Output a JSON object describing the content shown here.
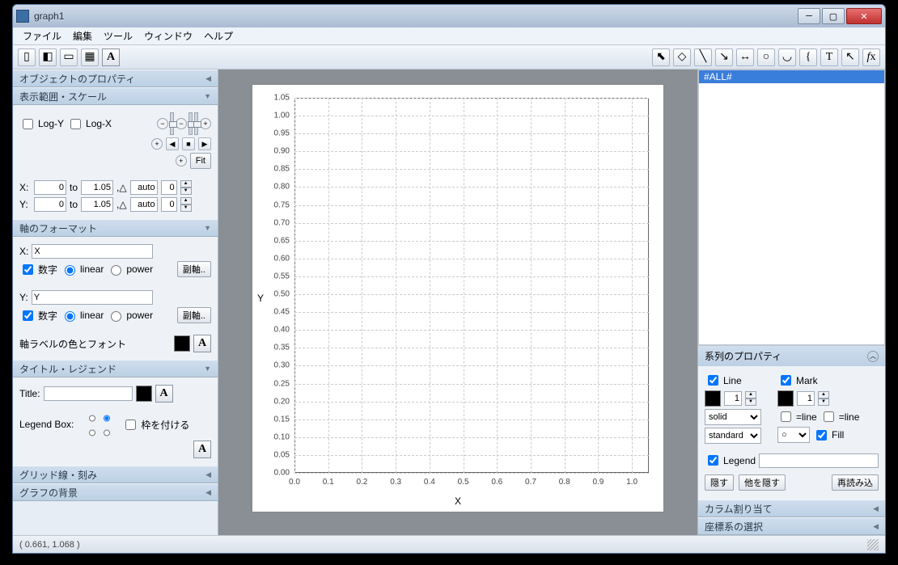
{
  "window": {
    "title": "graph1"
  },
  "menu": {
    "file": "ファイル",
    "edit": "編集",
    "tool": "ツール",
    "window": "ウィンドウ",
    "help": "ヘルプ"
  },
  "left": {
    "objprop": "オブジェクトのプロパティ",
    "range": "表示範囲・スケール",
    "logy": "Log-Y",
    "logx": "Log-X",
    "fit": "Fit",
    "x": "X:",
    "y": "Y:",
    "to": "to",
    "auto": "auto",
    "x_from": "0",
    "x_to": "1.05",
    "y_from": "0",
    "y_to": "1.05",
    "x_auto": "0",
    "y_auto": "0",
    "axisfmt": "軸のフォーマット",
    "xlabel_lbl": "X:",
    "xlabel_val": "X",
    "ylabel_lbl": "Y:",
    "ylabel_val": "Y",
    "num": "数字",
    "linear": "linear",
    "power": "power",
    "subaxis": "副軸..",
    "axiscolor": "軸ラベルの色とフォント",
    "titleleg": "タイトル・レジェンド",
    "title_lbl": "Title:",
    "title_val": "",
    "legendbox": "Legend Box:",
    "frame": "枠を付ける",
    "gridsec": "グリッド線・刻み",
    "bgsec": "グラフの背景"
  },
  "right": {
    "all": "#ALL#",
    "seriesprop": "系列のプロパティ",
    "line": "Line",
    "mark": "Mark",
    "line_w": "1",
    "mark_w": "1",
    "solid": "solid",
    "standard": "standard",
    "eqline": "=line",
    "fill": "Fill",
    "legend": "Legend",
    "legend_val": "",
    "hide": "隠す",
    "hideother": "他を隠す",
    "reload": "再読み込",
    "colassign": "カラム割り当て",
    "coordsel": "座標系の選択"
  },
  "status": {
    "coords": "( 0.661,  1.068 )"
  },
  "chart_data": {
    "type": "scatter",
    "series": [],
    "x": [],
    "y": [],
    "title": "",
    "xlabel": "X",
    "ylabel": "Y",
    "xlim": [
      0,
      1.05
    ],
    "ylim": [
      0,
      1.05
    ],
    "xticks": [
      0.0,
      0.1,
      0.2,
      0.3,
      0.4,
      0.5,
      0.6,
      0.7,
      0.8,
      0.9,
      1.0
    ],
    "yticks": [
      0.0,
      0.05,
      0.1,
      0.15,
      0.2,
      0.25,
      0.3,
      0.35,
      0.4,
      0.45,
      0.5,
      0.55,
      0.6,
      0.65,
      0.7,
      0.75,
      0.8,
      0.85,
      0.9,
      0.95,
      1.0,
      1.05
    ],
    "grid": true
  }
}
